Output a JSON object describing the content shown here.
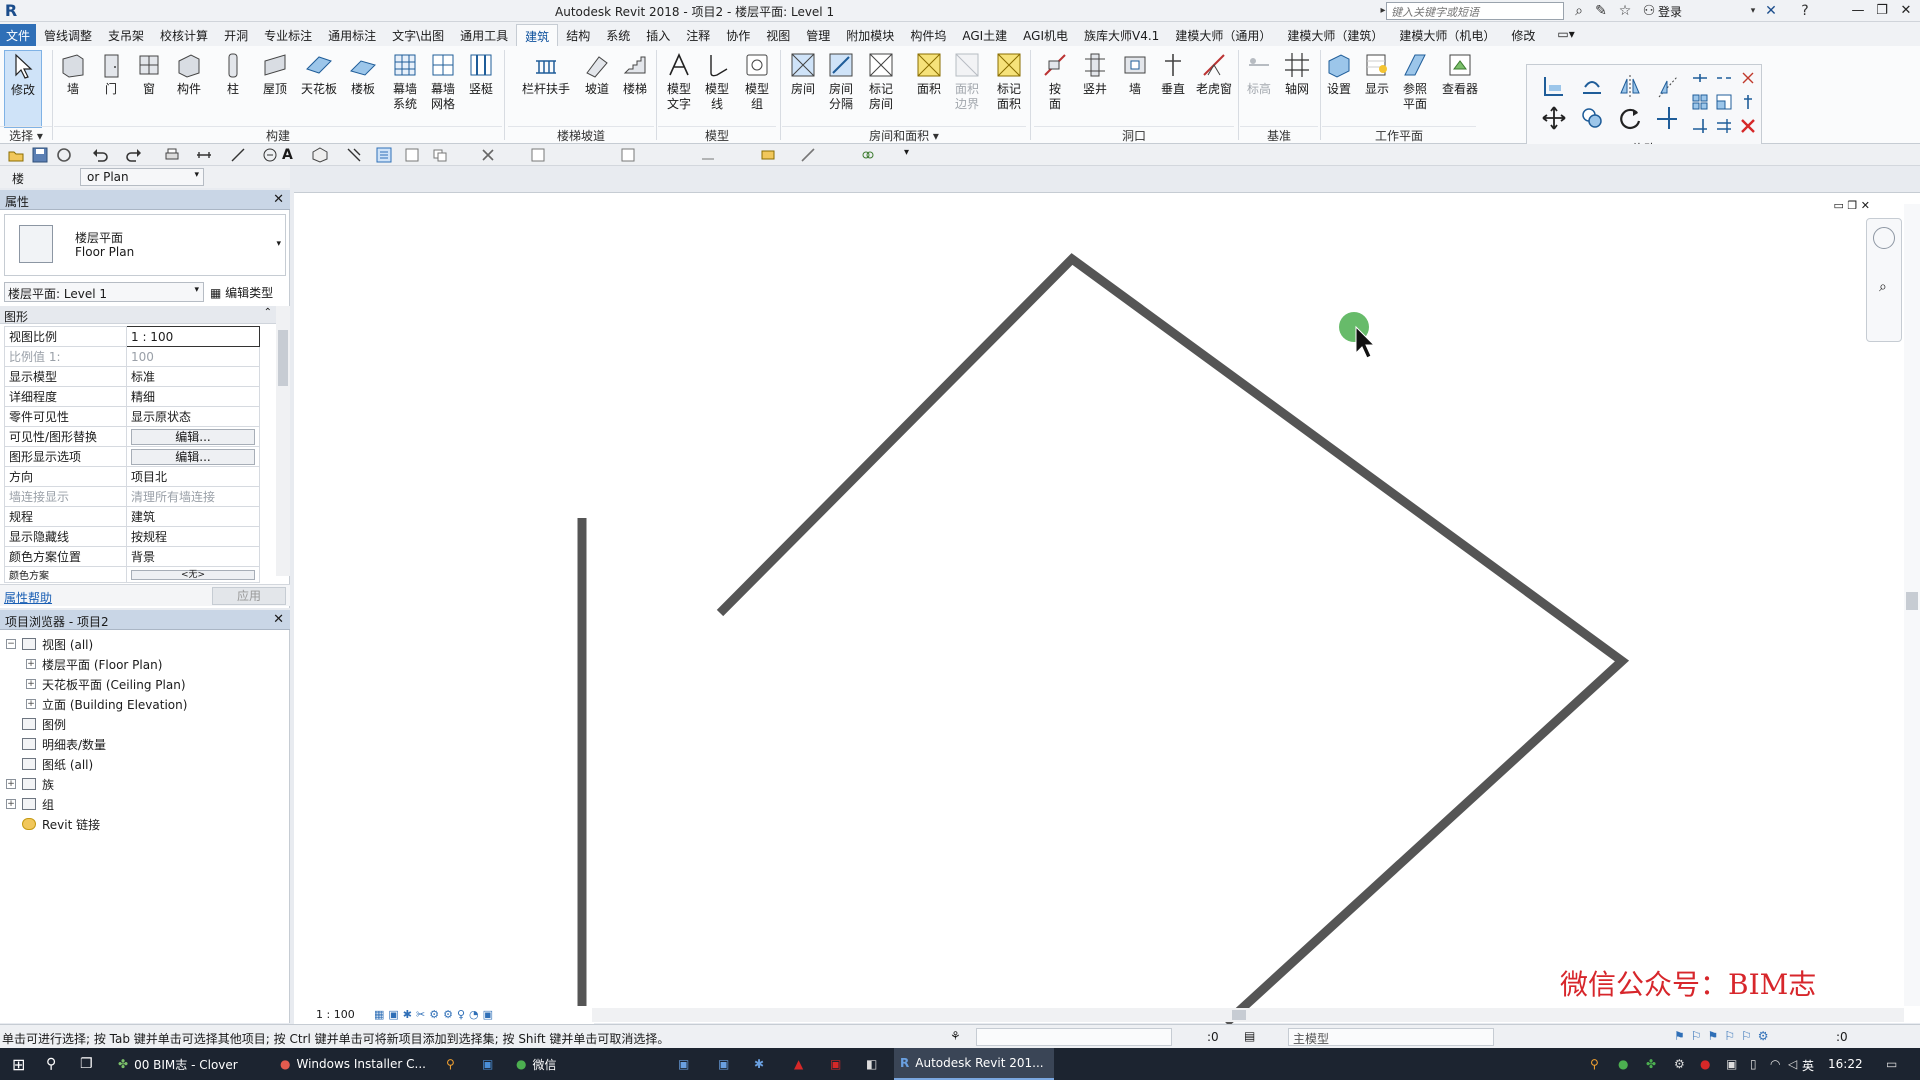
{
  "window": {
    "title": "Autodesk Revit 2018 -    项目2 - 楼层平面: Level 1",
    "search_placeholder": "键入关键字或短语",
    "login": "登录"
  },
  "ribbon_tabs": [
    {
      "label": "文件"
    },
    {
      "label": "管线调整"
    },
    {
      "label": "支吊架"
    },
    {
      "label": "校核计算"
    },
    {
      "label": "开洞"
    },
    {
      "label": "专业标注"
    },
    {
      "label": "通用标注"
    },
    {
      "label": "文字\\出图"
    },
    {
      "label": "通用工具"
    },
    {
      "label": "建筑"
    },
    {
      "label": "结构"
    },
    {
      "label": "系统"
    },
    {
      "label": "插入"
    },
    {
      "label": "注释"
    },
    {
      "label": "协作"
    },
    {
      "label": "视图"
    },
    {
      "label": "管理"
    },
    {
      "label": "附加模块"
    },
    {
      "label": "构件坞"
    },
    {
      "label": "AGI土建"
    },
    {
      "label": "AGI机电"
    },
    {
      "label": "族库大师V4.1"
    },
    {
      "label": "建模大师（通用）"
    },
    {
      "label": "建模大师（建筑）"
    },
    {
      "label": "建模大师（机电）"
    },
    {
      "label": "修改"
    }
  ],
  "ribbon": {
    "buttons": [
      {
        "line1": "修改",
        "line2": ""
      },
      {
        "line1": "墙",
        "line2": ""
      },
      {
        "line1": "门",
        "line2": ""
      },
      {
        "line1": "窗",
        "line2": ""
      },
      {
        "line1": "构件",
        "line2": ""
      },
      {
        "line1": "柱",
        "line2": ""
      },
      {
        "line1": "屋顶",
        "line2": ""
      },
      {
        "line1": "天花板",
        "line2": ""
      },
      {
        "line1": "楼板",
        "line2": ""
      },
      {
        "line1": "幕墙",
        "line2": "系统"
      },
      {
        "line1": "幕墙",
        "line2": "网格"
      },
      {
        "line1": "竖梃",
        "line2": ""
      },
      {
        "line1": "栏杆扶手",
        "line2": ""
      },
      {
        "line1": "坡道",
        "line2": ""
      },
      {
        "line1": "楼梯",
        "line2": ""
      },
      {
        "line1": "模型",
        "line2": "文字"
      },
      {
        "line1": "模型",
        "line2": "线"
      },
      {
        "line1": "模型",
        "line2": "组"
      },
      {
        "line1": "房间",
        "line2": ""
      },
      {
        "line1": "房间",
        "line2": "分隔"
      },
      {
        "line1": "标记",
        "line2": "房间"
      },
      {
        "line1": "面积",
        "line2": ""
      },
      {
        "line1": "面积",
        "line2": "边界"
      },
      {
        "line1": "标记",
        "line2": "面积"
      },
      {
        "line1": "按",
        "line2": "面"
      },
      {
        "line1": "竖井",
        "line2": ""
      },
      {
        "line1": "墙",
        "line2": ""
      },
      {
        "line1": "垂直",
        "line2": ""
      },
      {
        "line1": "老虎窗",
        "line2": ""
      },
      {
        "line1": "标高",
        "line2": ""
      },
      {
        "line1": "轴网",
        "line2": ""
      },
      {
        "line1": "设置",
        "line2": ""
      },
      {
        "line1": "显示",
        "line2": ""
      },
      {
        "line1": "参照",
        "line2": "平面"
      },
      {
        "line1": "查看器",
        "line2": ""
      }
    ],
    "groups": {
      "select": "选择 ▾",
      "build": "构建",
      "circulation": "楼梯坡道",
      "model": "模型",
      "room_area": "房间和面积 ▾",
      "opening": "洞口",
      "datum": "基准",
      "workplane": "工作平面",
      "modify": "修改"
    }
  },
  "type_selector": {
    "label": "楼",
    "value": "or Plan"
  },
  "properties": {
    "title": "属性",
    "type_name_cn": "楼层平面",
    "type_name_en": "Floor Plan",
    "instance": "楼层平面: Level 1",
    "edit_type": "编辑类型",
    "category": "图形",
    "rows": [
      {
        "key": "视图比例",
        "value": "1 : 100",
        "style": "boxed"
      },
      {
        "key": "比例值 1:",
        "value": "100",
        "style": "dim"
      },
      {
        "key": "显示模型",
        "value": "标准",
        "style": ""
      },
      {
        "key": "详细程度",
        "value": "精细",
        "style": ""
      },
      {
        "key": "零件可见性",
        "value": "显示原状态",
        "style": ""
      },
      {
        "key": "可见性/图形替换",
        "value": "编辑...",
        "style": "button"
      },
      {
        "key": "图形显示选项",
        "value": "编辑...",
        "style": "button"
      },
      {
        "key": "方向",
        "value": "项目北",
        "style": ""
      },
      {
        "key": "墙连接显示",
        "value": "清理所有墙连接",
        "style": "dim"
      },
      {
        "key": "规程",
        "value": "建筑",
        "style": ""
      },
      {
        "key": "显示隐藏线",
        "value": "按规程",
        "style": ""
      },
      {
        "key": "颜色方案位置",
        "value": "背景",
        "style": ""
      },
      {
        "key": "颜色方案",
        "value": "<无>",
        "style": "button"
      }
    ],
    "help_link": "属性帮助",
    "apply": "应用"
  },
  "project_browser": {
    "title": "项目浏览器 - 项目2",
    "items": [
      {
        "label": "视图 (all)",
        "depth": 0,
        "expander": "−"
      },
      {
        "label": "楼层平面 (Floor Plan)",
        "depth": 1,
        "expander": "+"
      },
      {
        "label": "天花板平面 (Ceiling Plan)",
        "depth": 1,
        "expander": "+"
      },
      {
        "label": "立面 (Building Elevation)",
        "depth": 1,
        "expander": "+"
      },
      {
        "label": "图例",
        "depth": 0,
        "expander": ""
      },
      {
        "label": "明细表/数量",
        "depth": 0,
        "expander": ""
      },
      {
        "label": "图纸 (all)",
        "depth": 0,
        "expander": ""
      },
      {
        "label": "族",
        "depth": 0,
        "expander": "+"
      },
      {
        "label": "组",
        "depth": 0,
        "expander": "+"
      },
      {
        "label": "Revit 链接",
        "depth": 0,
        "expander": ""
      }
    ]
  },
  "view": {
    "scale": "1 : 100",
    "watermark": "微信公众号：BIM志"
  },
  "statusbar": {
    "message": "单击可进行选择; 按 Tab 键并单击可选择其他项目; 按 Ctrl 键并单击可将新项目添加到选择集; 按 Shift 键并单击可取消选择。",
    "zero": ":0",
    "model": "主模型",
    "filter": ":0"
  },
  "taskbar": {
    "items": [
      {
        "label": "00 BIM志 - Clover"
      },
      {
        "label": "Windows Installer C..."
      },
      {
        "label": "微信"
      },
      {
        "label": "Autodesk Revit 201..."
      }
    ],
    "ime": "英",
    "time": "16:22"
  },
  "colors": {
    "accent": "#2f6fb7",
    "wall": "#555555",
    "watermark": "#d7262b",
    "cursor_dot": "#4caf50"
  }
}
